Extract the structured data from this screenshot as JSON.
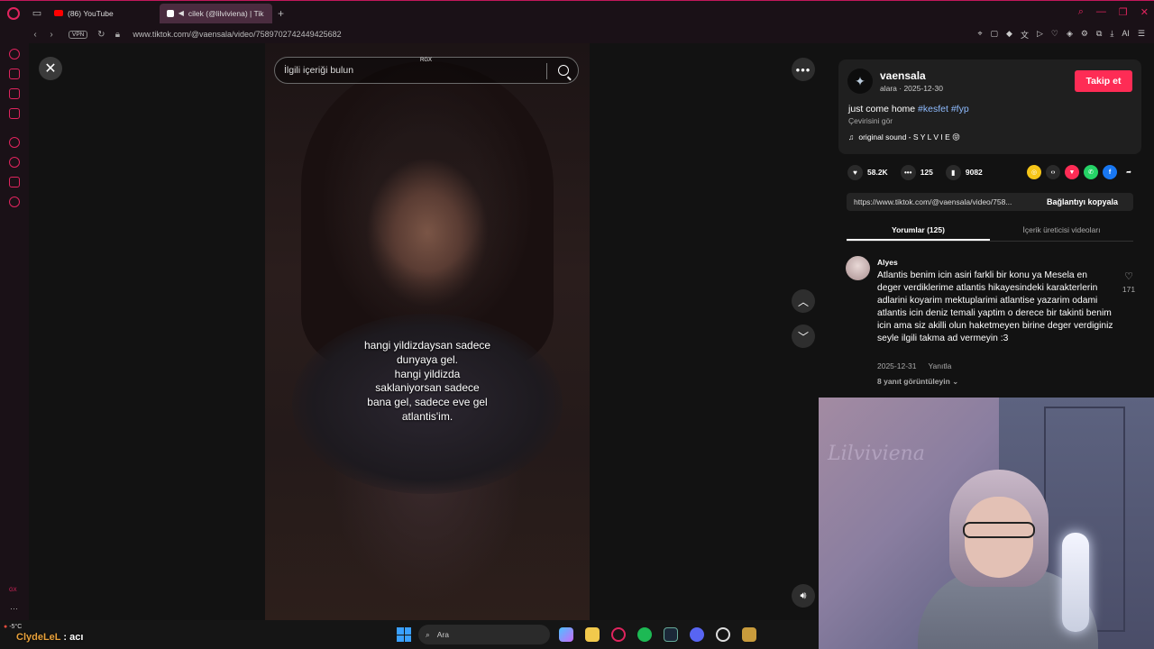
{
  "browser": {
    "tabs": [
      {
        "title": "(86) YouTube",
        "active": false
      },
      {
        "title": "cilek (@lilviviena) | Tik",
        "active": true
      }
    ],
    "url": "www.tiktok.com/@vaensala/video/7589702742449425682",
    "vpn_label": "VPN"
  },
  "video": {
    "search_placeholder": "İlgili içeriği bulun",
    "overlay_tag": "RGX",
    "caption": "hangi yildizdaysan sadece dunyaya gel.\nhangi yildizda saklaniyorsan sadece bana gel, sadece eve gel atlantis'im."
  },
  "post": {
    "author": "vaensala",
    "author_meta": "alara · 2025-12-30",
    "follow_label": "Takip et",
    "desc_text": "just come home ",
    "hashtags": "#kesfet #fyp",
    "translate_label": "Çevirisini gör",
    "sound": "original sound - S Y L V I E 😝",
    "likes": "58.2K",
    "comments": "125",
    "saves": "9082",
    "link_url": "https://www.tiktok.com/@vaensala/video/758...",
    "copy_label": "Bağlantıyı kopyala",
    "tab_comments": "Yorumlar (125)",
    "tab_creator": "İçerik üreticisi videoları"
  },
  "comment": {
    "user": "Alyes",
    "text": "Atlantis benim icin asiri farkli bir konu ya Mesela en deger verdiklerime atlantis hikayesindeki karakterlerin adlarini koyarim mektuplarimi atlantise yazarim odami atlantis icin deniz temali yaptim o derece bir takinti benim icin ama siz akilli olun haketmeyen birine deger verdiginiz seyle ilgili takma ad vermeyin :3",
    "date": "2025-12-31",
    "reply_label": "Yanıtla",
    "likes": "171",
    "replies_label": "8 yanıt görüntüleyin"
  },
  "taskbar": {
    "temperature": "-5°C",
    "streamer_name": "ClydeLeL",
    "streamer_msg": " : acı",
    "search_label": "Ara"
  },
  "webcam": {
    "neon_text": "Lilviviena"
  },
  "colors": {
    "accent": "#fe2c55",
    "opera_red": "#e0245e",
    "hashtag": "#8fbcff"
  }
}
